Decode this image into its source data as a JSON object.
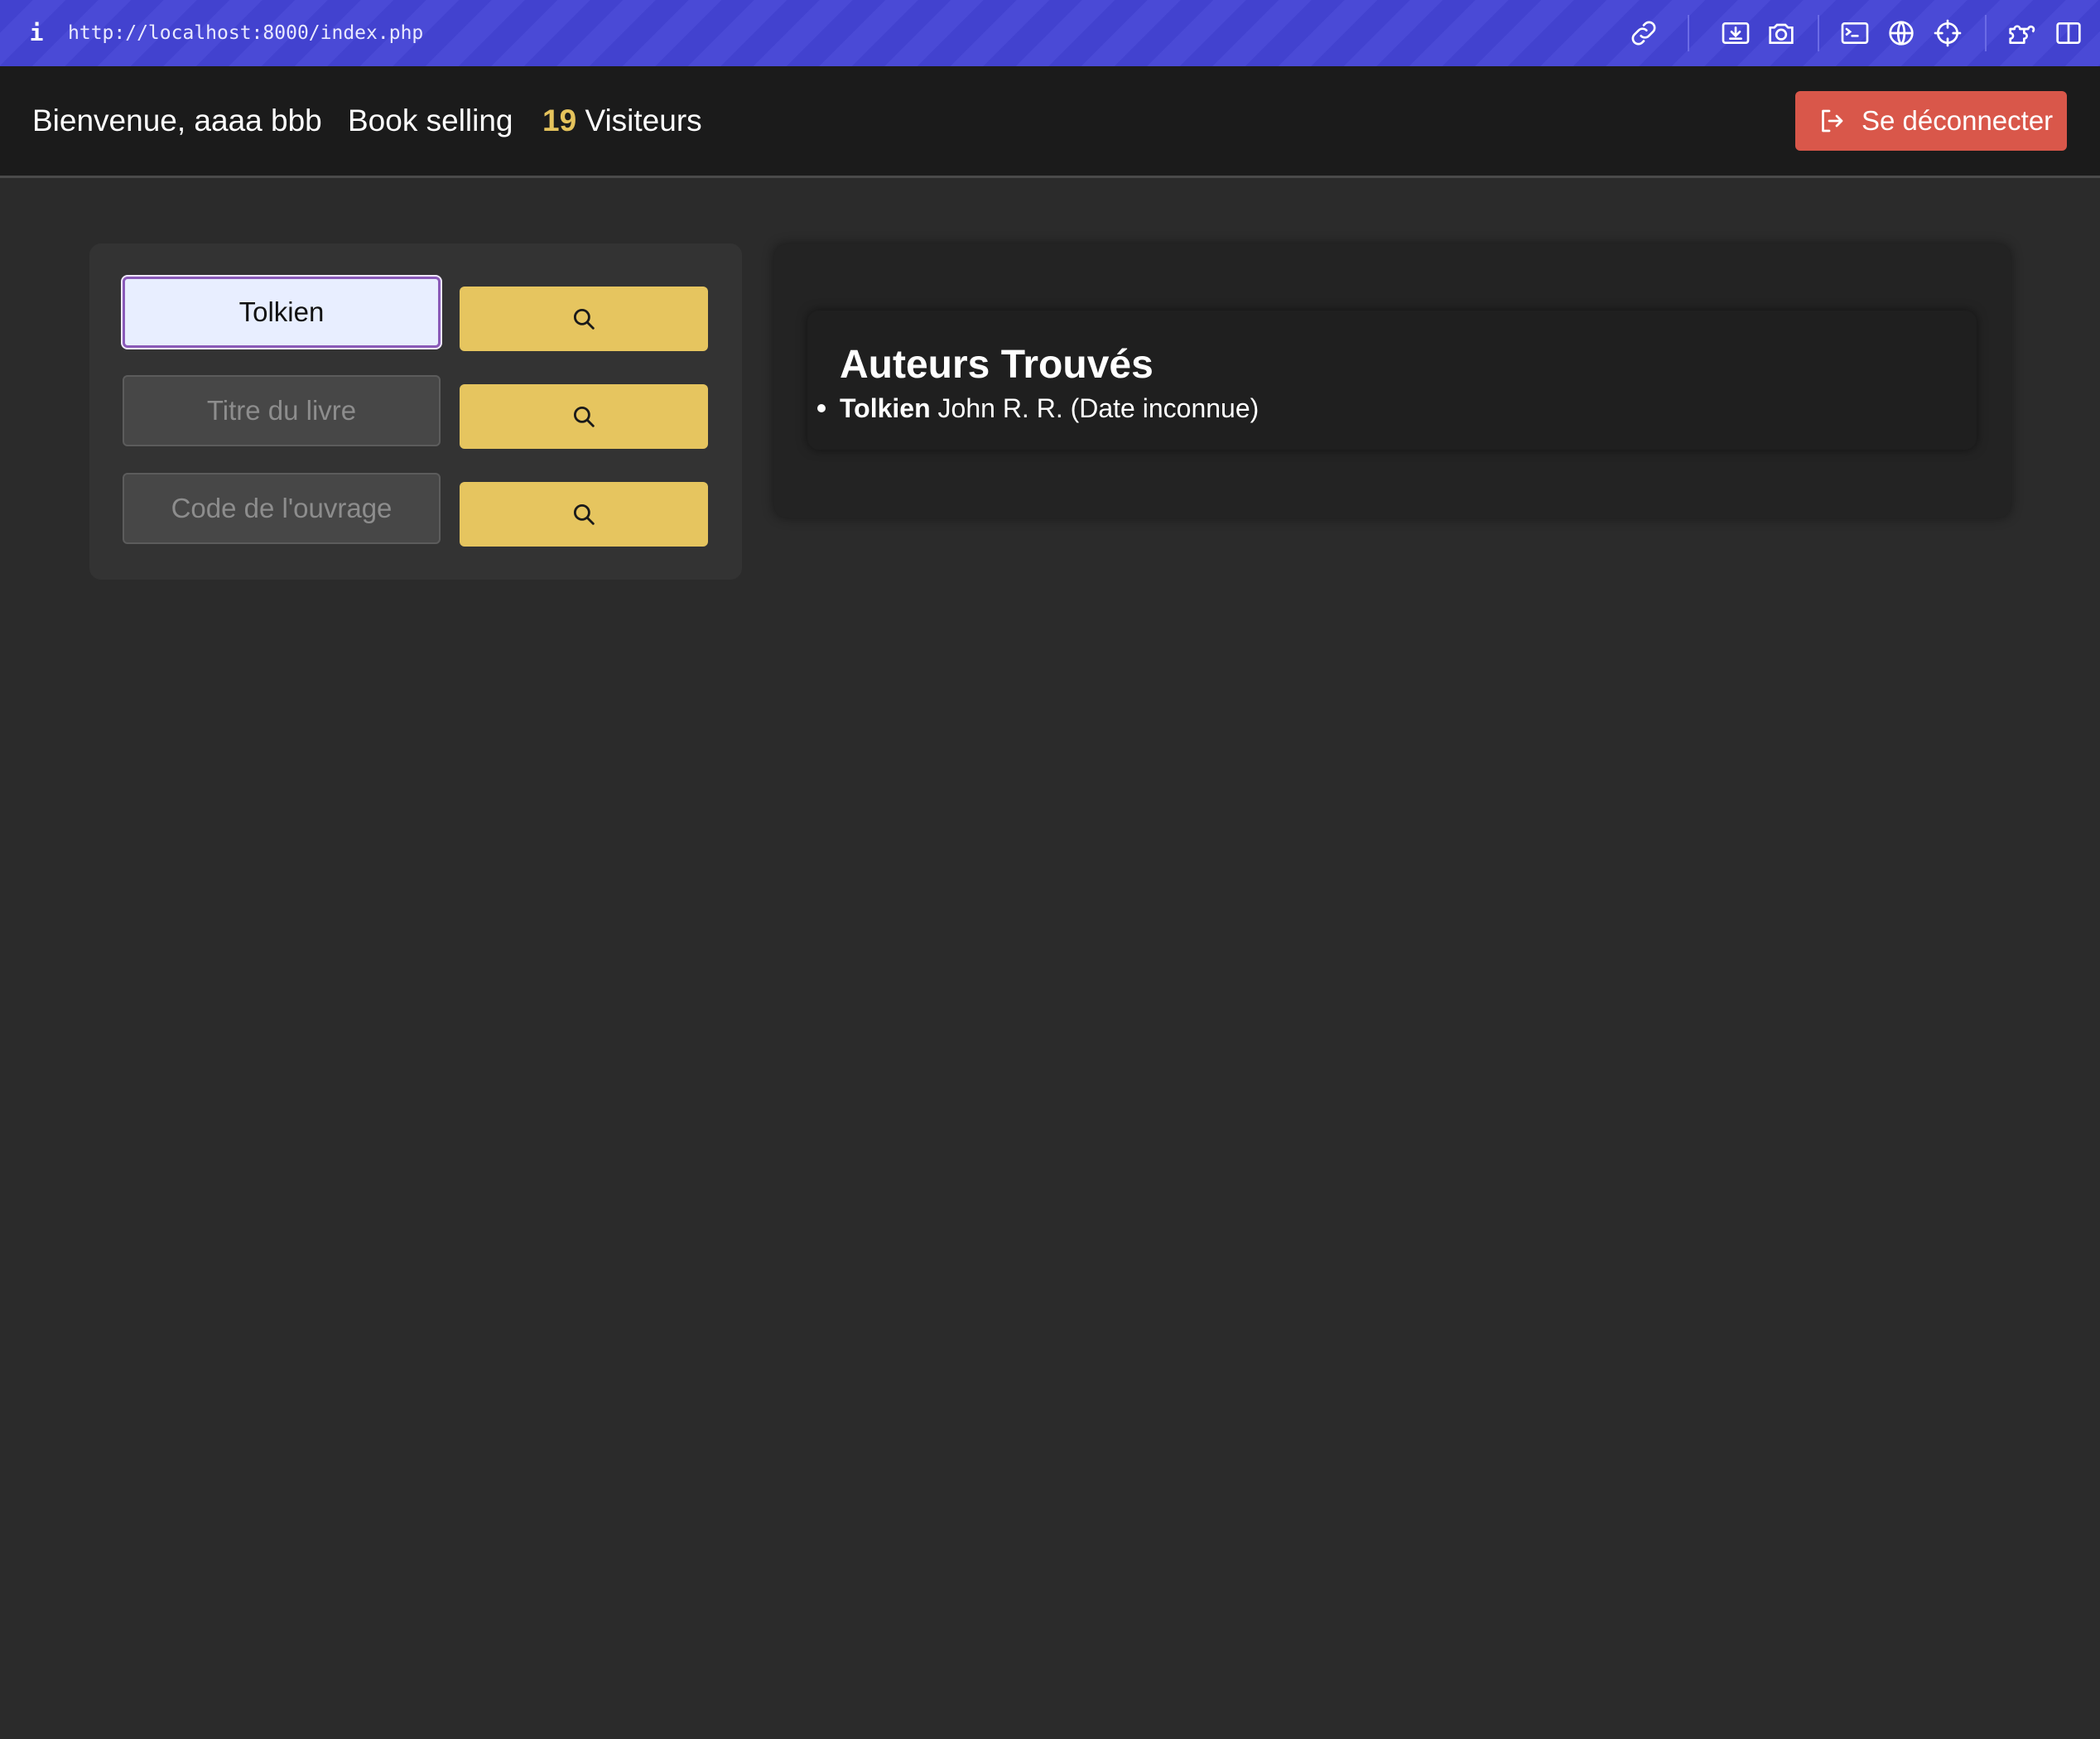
{
  "browser": {
    "info_icon": "i",
    "url": "http://localhost:8000/index.php",
    "toolbar_icons": [
      "link-icon",
      "download-screenshot-icon",
      "camera-icon",
      "terminal-icon",
      "globe-icon",
      "crosshair-icon",
      "extension-icon",
      "sidebar-icon"
    ]
  },
  "header": {
    "welcome": "Bienvenue, aaaa bbb",
    "title": "Book selling",
    "visitor_count": "19",
    "visitor_label": "Visiteurs",
    "logout_label": "Se déconnecter"
  },
  "search": {
    "author_value": "Tolkien",
    "title_placeholder": "Titre du livre",
    "code_placeholder": "Code de l'ouvrage",
    "button_icon": "search-icon"
  },
  "results": {
    "heading": "Auteurs Trouvés",
    "items": [
      {
        "surname": "Tolkien",
        "details": "John R. R. (Date inconnue)"
      }
    ]
  },
  "colors": {
    "browser_bar": "#4242cf",
    "header_bg": "#1b1b1b",
    "page_bg": "#2b2b2b",
    "accent_yellow": "#e6c55f",
    "logout_red": "#d9574a"
  }
}
